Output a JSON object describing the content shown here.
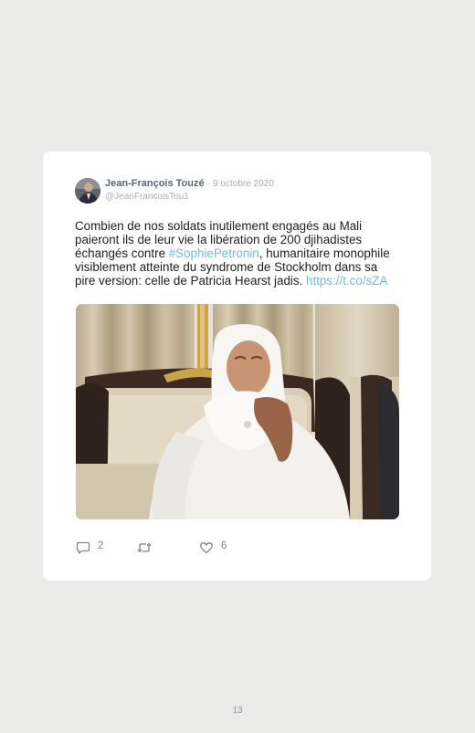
{
  "tweet": {
    "author_name": "Jean-François Touzé",
    "separator": "·",
    "date": "9 octobre 2020",
    "handle": "@JeanFrancoisTou1",
    "text_before_hashtag": "Combien de nos soldats inutilement engagés au Mali paieront ils de leur vie la libération de 200 djihadistes échangés contre ",
    "hashtag": "#SophiePetronin",
    "text_after_hashtag": ", humanitaire monophile visiblement atteinte du syndrome de Stockholm dans sa pire version: celle de Patricia Hearst jadis. ",
    "link": "https://t.co/sZA",
    "actions": {
      "reply_count": "2",
      "retweet_count": "",
      "like_count": "6"
    },
    "icons": {
      "reply": "speech-bubble-icon",
      "retweet": "retweet-icon",
      "like": "heart-icon"
    }
  },
  "page": {
    "number": "13"
  },
  "colors": {
    "page_background": "#ebebea",
    "card_background": "#ffffff",
    "link": "#6cbcde",
    "muted_text": "#a7aeb6"
  }
}
